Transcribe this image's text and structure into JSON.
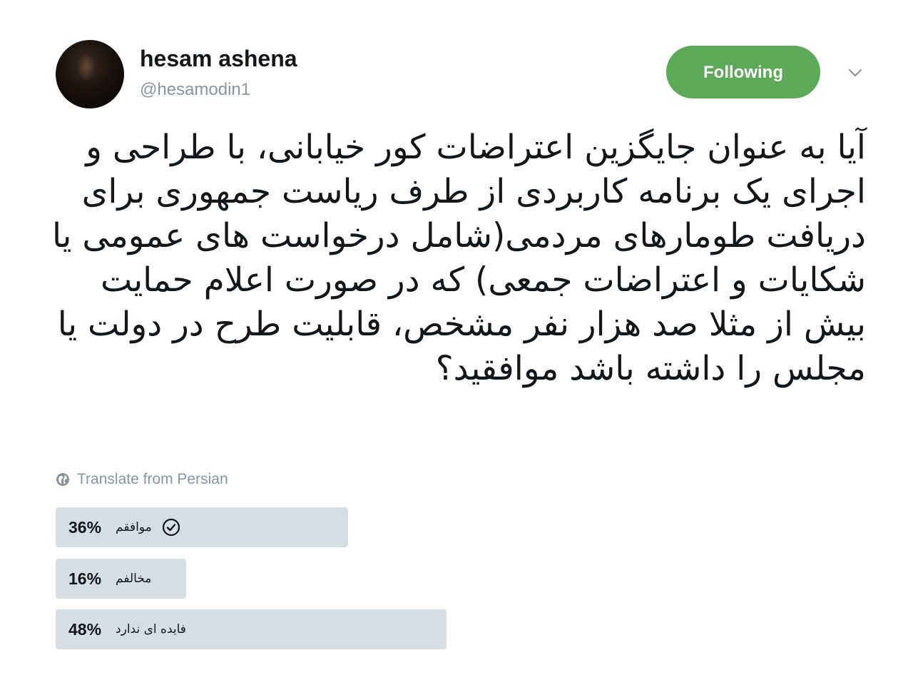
{
  "tweet": {
    "author": {
      "display_name": "hesam ashena",
      "handle": "@hesamodin1"
    },
    "follow_button_label": "Following",
    "text": "آیا به عنوان جایگزین اعتراضات کور خیابانی، با طراحی و اجرای یک برنامه کاربردی از طرف ریاست جمهوری برای دریافت طومارهای مردمی(شامل درخواست های عمومی یا شکایات و اعتراضات جمعی) که در صورت اعلام حمایت بیش از مثلا صد هزار نفر مشخص، قابلیت طرح در دولت یا مجلس را داشته باشد موافقید؟",
    "translate_label": "Translate from Persian"
  },
  "poll": {
    "options": [
      {
        "percent_label": "36%",
        "percent": 36,
        "label": "موافقم",
        "selected": true
      },
      {
        "percent_label": "16%",
        "percent": 16,
        "label": "مخالفم",
        "selected": false
      },
      {
        "percent_label": "48%",
        "percent": 48,
        "label": "فایده ای ندارد",
        "selected": false
      }
    ]
  },
  "colors": {
    "follow_button": "#5ca957",
    "poll_bar": "#d6dee4",
    "secondary_text": "#8a949d"
  }
}
